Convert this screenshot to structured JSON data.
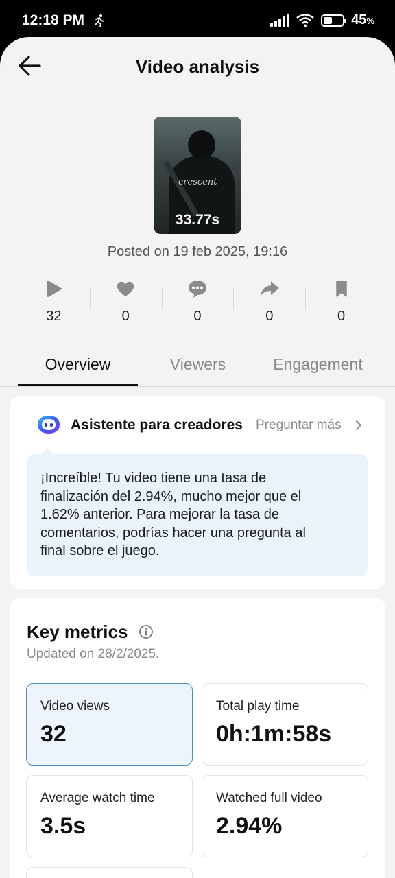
{
  "status_bar": {
    "time": "12:18 PM",
    "battery_percent": "45",
    "battery_symbol": "%",
    "battery_level": 0.45,
    "icons": [
      "running-icon",
      "signal-icon",
      "wifi-icon",
      "battery-icon"
    ]
  },
  "header": {
    "title": "Video analysis",
    "back_icon": "back-arrow-icon"
  },
  "video": {
    "duration": "33.77s",
    "thumbnail_text": "crescent",
    "posted": "Posted on 19 feb 2025, 19:16"
  },
  "stats": [
    {
      "icon": "play-icon",
      "value": "32"
    },
    {
      "icon": "heart-icon",
      "value": "0"
    },
    {
      "icon": "comment-icon",
      "value": "0"
    },
    {
      "icon": "share-icon",
      "value": "0"
    },
    {
      "icon": "bookmark-icon",
      "value": "0"
    }
  ],
  "tabs": [
    {
      "label": "Overview",
      "active": true
    },
    {
      "label": "Viewers",
      "active": false
    },
    {
      "label": "Engagement",
      "active": false
    }
  ],
  "assistant": {
    "title": "Asistente para creadores",
    "more_label": "Preguntar más",
    "message_lines": [
      "¡Increíble! Tu video tiene una tasa de",
      "finalización del 2.94%, mucho mejor que el",
      "1.62% anterior. Para mejorar la tasa de",
      "comentarios, podrías hacer una pregunta al",
      "final sobre el juego."
    ]
  },
  "key_metrics": {
    "title": "Key metrics",
    "updated": "Updated on 28/2/2025.",
    "items": [
      {
        "label": "Video views",
        "value": "32",
        "selected": true
      },
      {
        "label": "Total play time",
        "value": "0h:1m:58s",
        "selected": false
      },
      {
        "label": "Average watch time",
        "value": "3.5s",
        "selected": false
      },
      {
        "label": "Watched full video",
        "value": "2.94%",
        "selected": false
      }
    ]
  },
  "colors": {
    "accent_blue": "#4a8fc0",
    "bubble_bg": "#eaf3fc",
    "page_bg": "#f3f3f3"
  }
}
